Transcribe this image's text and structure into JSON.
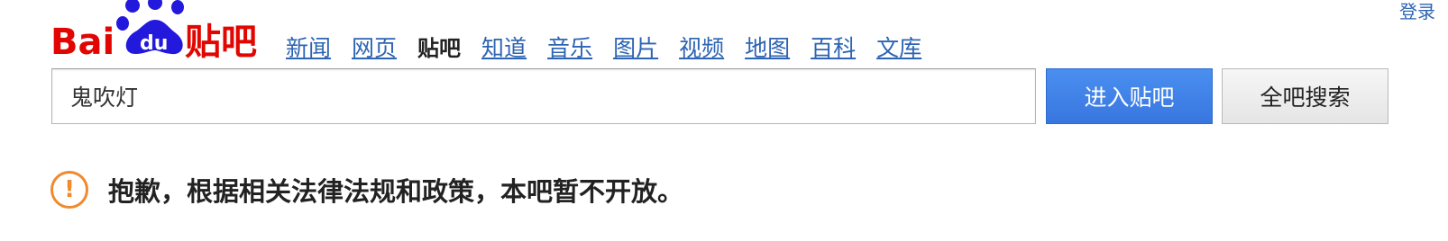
{
  "header": {
    "login_label": "登录"
  },
  "logo": {
    "bai": "Bai",
    "du": "du",
    "tieba": "贴吧"
  },
  "nav": [
    {
      "label": "新闻",
      "active": false
    },
    {
      "label": "网页",
      "active": false
    },
    {
      "label": "贴吧",
      "active": true
    },
    {
      "label": "知道",
      "active": false
    },
    {
      "label": "音乐",
      "active": false
    },
    {
      "label": "图片",
      "active": false
    },
    {
      "label": "视频",
      "active": false
    },
    {
      "label": "地图",
      "active": false
    },
    {
      "label": "百科",
      "active": false
    },
    {
      "label": "文库",
      "active": false
    }
  ],
  "search": {
    "value": "鬼吹灯"
  },
  "buttons": {
    "enter_label": "进入贴吧",
    "search_all_label": "全吧搜索"
  },
  "notice": {
    "icon": "!",
    "text": "抱歉，根据相关法律法规和政策，本吧暂不开放。"
  },
  "colors": {
    "brand_red": "#e10601",
    "brand_blue": "#2319dc",
    "link": "#2d64b3",
    "warning": "#f08a2e",
    "button_blue": "#3876df"
  }
}
